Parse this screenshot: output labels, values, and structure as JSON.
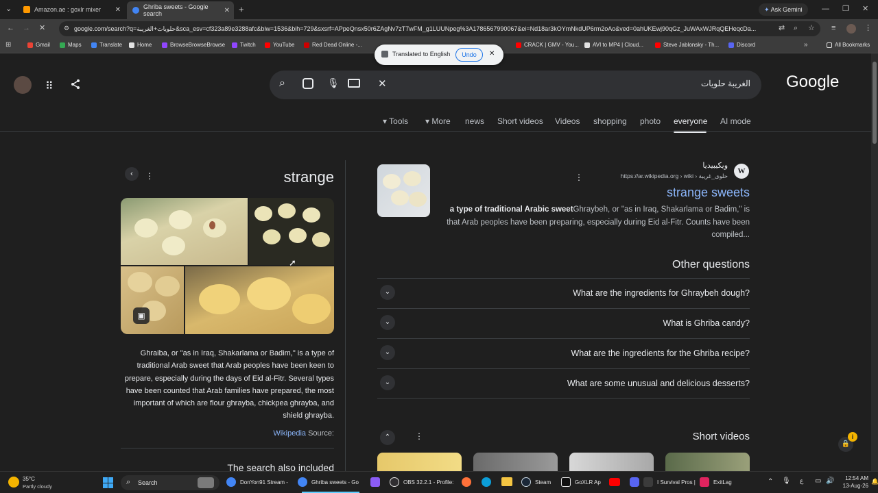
{
  "browser": {
    "tabs": [
      {
        "title": "Amazon.ae : goxlr mixer",
        "color": "#ff9900"
      },
      {
        "title": "Ghriba sweets - Google search",
        "color": "#4285f4"
      }
    ],
    "ask_gemini": "Ask Gemini",
    "url": "google.com/search?q=حلويات+الغريبة&sca_esv=cf323a89e3288afc&biw=1536&bih=729&sxsrf=APpeQnsx50r6ZAgNv7zT7wFM_g1LUUNpeg%3A1786567990067&ei=Nd18ar3kOYmNkdUP6rm2oAo&ved=0ahUKEwj90qGz_JuWAxWJRqQEHeqcDa...",
    "translate_popup": {
      "text": "Translated to English",
      "undo": "Undo"
    },
    "bookmarks": [
      {
        "label": "Gmail",
        "color": "#ea4335"
      },
      {
        "label": "Maps",
        "color": "#34a853"
      },
      {
        "label": "Translate",
        "color": "#4285f4"
      },
      {
        "label": "Home",
        "color": "#e3e3e3"
      },
      {
        "label": "BrowseBrowseBrowse",
        "color": "#9146ff"
      },
      {
        "label": "Twitch",
        "color": "#9146ff"
      },
      {
        "label": "YouTube",
        "color": "#ff0000"
      },
      {
        "label": "Red Dead Online -...",
        "color": "#cc0000"
      },
      {
        "label": "CRACK | GMV - You...",
        "color": "#ff0000"
      },
      {
        "label": "AVI to MP4 | Cloud...",
        "color": "#e3e3e3"
      },
      {
        "label": "Steve Jablonsky - Th...",
        "color": "#ff0000"
      },
      {
        "label": "Discord",
        "color": "#5865f2"
      }
    ],
    "all_bookmarks": "All Bookmarks"
  },
  "google": {
    "logo": "Google",
    "query": "الغريبة حلويات",
    "tabs": [
      "Tools",
      "More",
      "news",
      "Short videos",
      "Videos",
      "shopping",
      "photo",
      "everyone",
      "AI mode"
    ],
    "active_tab": "everyone"
  },
  "knowledge_panel": {
    "title": "strange",
    "description": "Ghraiba, or \"as in Iraq, Shakarlama or Badim,\" is a type of traditional Arab sweet that Arab peoples have been keen to prepare, especially during the days of Eid al-Fitr. Several types have been counted that Arab families have prepared, the most important of which are flour ghrayba, chickpea ghrayba, and shield ghrayba.",
    "source_link": "Wikipedia",
    "source_label": "Source:",
    "also_searched": "The search also included"
  },
  "result": {
    "site_name": "ويكيبيديا",
    "breadcrumb": "https://ar.wikipedia.org › wiki › حلوى_غريبة",
    "title": "strange sweets",
    "snippet_bold": "a type of traditional Arabic sweet",
    "snippet": "Ghraybeh, or \"as in Iraq, Shakarlama or Badim,\" is that Arab peoples have been preparing, especially during Eid al-Fitr. Counts have been compiled..."
  },
  "paa": {
    "heading": "Other questions",
    "questions": [
      "What are the ingredients for Ghraybeh dough?",
      "What is Ghriba candy?",
      "What are the ingredients for the Ghriba recipe?",
      "What are some unusual and delicious desserts?"
    ]
  },
  "short_videos": {
    "heading": "Short videos"
  },
  "taskbar": {
    "weather_temp": "35°C",
    "weather_desc": "Partly cloudy",
    "search": "Search",
    "apps": [
      "DonYon91 Stream -",
      "Ghriba sweets - Go",
      "OBS 32.2.1 - Profile:",
      "Steam",
      "GoXLR Ap",
      "I Survival Pros |",
      "ExitLag"
    ],
    "time": "12:54 AM",
    "date": "13-Aug-26"
  }
}
